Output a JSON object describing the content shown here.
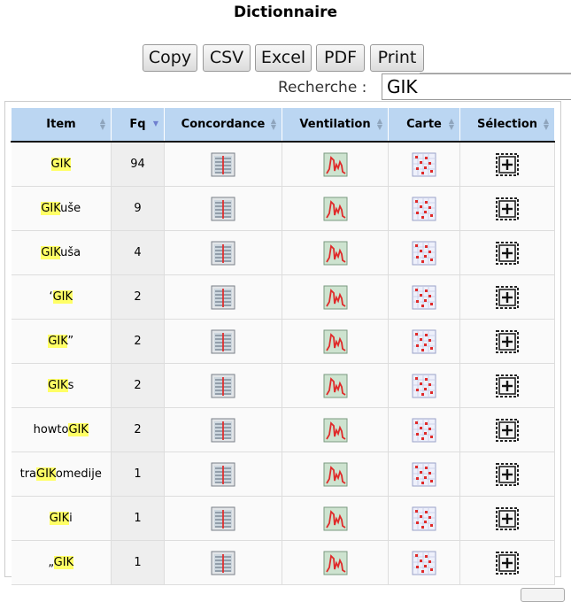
{
  "title": "Dictionnaire",
  "toolbar": {
    "copy": "Copy",
    "csv": "CSV",
    "excel": "Excel",
    "pdf": "PDF",
    "print": "Print"
  },
  "search": {
    "label": "Recherche :",
    "value": "GIK"
  },
  "table": {
    "headers": {
      "item": "Item",
      "fq": "Fq",
      "concordance": "Concordance",
      "ventilation": "Ventilation",
      "carte": "Carte",
      "selection": "Sélection"
    },
    "sort_column": "Fq",
    "sort_direction": "descending",
    "rows": [
      {
        "pre": "",
        "match": "GIK",
        "post": "",
        "fq": "94"
      },
      {
        "pre": "",
        "match": "GIK",
        "post": "uše",
        "fq": "9"
      },
      {
        "pre": "",
        "match": "GIK",
        "post": "uša",
        "fq": "4"
      },
      {
        "pre": "‘",
        "match": "GIK",
        "post": "",
        "fq": "2"
      },
      {
        "pre": "",
        "match": "GIK",
        "post": "”",
        "fq": "2"
      },
      {
        "pre": "",
        "match": "GIK",
        "post": "s",
        "fq": "2"
      },
      {
        "pre": "howto",
        "match": "GIK",
        "post": "",
        "fq": "2"
      },
      {
        "pre": "tra",
        "match": "GIK",
        "post": "omedije",
        "fq": "1"
      },
      {
        "pre": "",
        "match": "GIK",
        "post": "i",
        "fq": "1"
      },
      {
        "pre": "„",
        "match": "GIK",
        "post": "",
        "fq": "1"
      }
    ]
  },
  "icons": {
    "concordance": "concordance-list-icon",
    "ventilation": "ventilation-chart-icon",
    "carte": "map-grid-icon",
    "selection": "select-plus-icon"
  },
  "colors": {
    "header_bg": "#bbd6f2",
    "highlight": "#ffff66",
    "fq_bg": "#eeeeee"
  }
}
